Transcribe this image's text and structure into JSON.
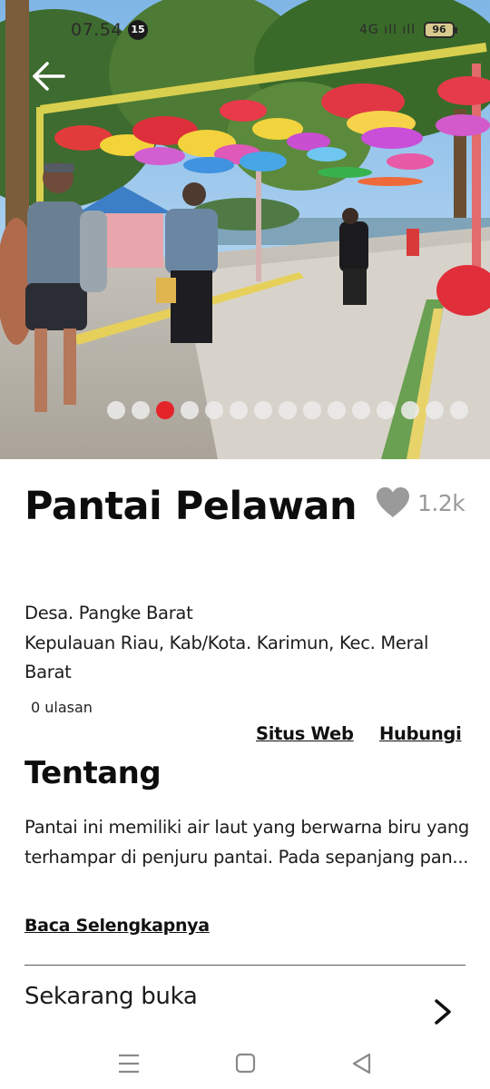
{
  "status_bar": {
    "time": "07.54",
    "notification_count": "15",
    "signal": "4G ıll ıll",
    "battery": "96"
  },
  "gallery": {
    "image_count": 15,
    "active_index": 2
  },
  "place": {
    "name": "Pantai Pelawan",
    "like_count": "1.2k",
    "address_line1": "Desa. Pangke Barat",
    "address_line2": "Kepulauan Riau, Kab/Kota. Karimun, Kec. Meral Barat",
    "reviews": "0 ulasan"
  },
  "actions": {
    "website": "Situs Web",
    "contact": "Hubungi"
  },
  "about": {
    "heading": "Tentang",
    "text": "Pantai ini memiliki air laut yang berwarna biru yang terhampar di penjuru pantai. Pada sepanjang pan...",
    "read_more": "Baca Selengkapnya"
  },
  "hours": {
    "status": "Sekarang buka"
  },
  "colors": {
    "accent_dot": "#e5242a",
    "like_icon": "#9a9a9a"
  },
  "icons": {
    "back": "arrow-left-icon",
    "like": "heart-icon",
    "chevron": "chevron-right-icon",
    "nav_menu": "menu-icon",
    "nav_home": "square-home-icon",
    "nav_back": "triangle-back-icon"
  }
}
